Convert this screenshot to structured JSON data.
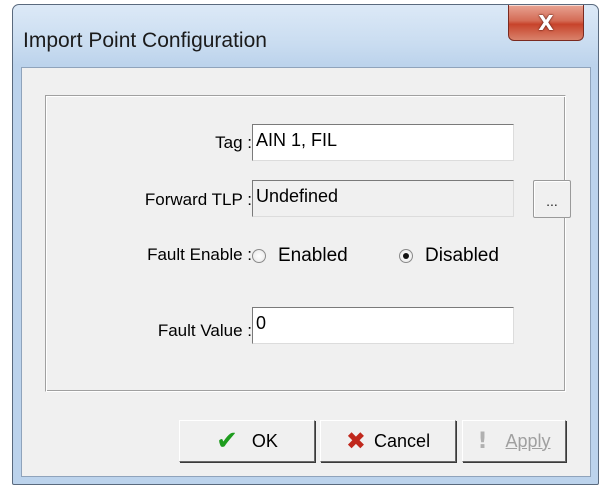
{
  "window": {
    "title": "Import Point Configuration",
    "close_glyph": "X"
  },
  "fields": {
    "tag": {
      "label": "Tag :",
      "value": "AIN 1, FIL"
    },
    "forward_tlp": {
      "label": "Forward TLP :",
      "value": "Undefined",
      "browse_label": "...",
      "enabled": false
    },
    "fault_enable": {
      "label": "Fault Enable :",
      "options": [
        {
          "label": "Enabled",
          "selected": false
        },
        {
          "label": "Disabled",
          "selected": true
        }
      ]
    },
    "fault_value": {
      "label": "Fault Value :",
      "value": "0"
    }
  },
  "buttons": {
    "ok": {
      "label": "OK",
      "icon": "check-icon",
      "icon_color": "#1e9c1e"
    },
    "cancel": {
      "label": "Cancel",
      "icon": "x-icon",
      "icon_color": "#c0281c"
    },
    "apply": {
      "label": "Apply",
      "icon": "exclamation-icon",
      "enabled": false
    }
  }
}
